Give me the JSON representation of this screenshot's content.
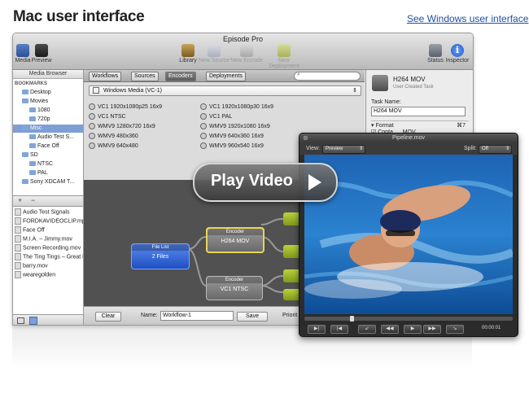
{
  "page": {
    "title": "Mac user interface",
    "windows_link": "See Windows user interface"
  },
  "window": {
    "title": "Episode Pro",
    "toolbar": {
      "media": "Media",
      "preview": "Preview",
      "library": "Library",
      "new_source": "New Source",
      "new_encode": "New Encode",
      "new_deployment": "New Deployment",
      "status": "Status",
      "inspector": "Inspector"
    }
  },
  "sidebar": {
    "header": "Media Browser",
    "tree": [
      {
        "label": "BOOKMARKS",
        "indent": 0
      },
      {
        "label": "Desktop",
        "indent": 1
      },
      {
        "label": "Movies",
        "indent": 1
      },
      {
        "label": "1080",
        "indent": 2
      },
      {
        "label": "720p",
        "indent": 2
      },
      {
        "label": "Misc",
        "indent": 1,
        "selected": true
      },
      {
        "label": "Audio Test S...",
        "indent": 2
      },
      {
        "label": "Face Off",
        "indent": 2
      },
      {
        "label": "SD",
        "indent": 1
      },
      {
        "label": "NTSC",
        "indent": 2
      },
      {
        "label": "PAL",
        "indent": 2
      },
      {
        "label": "Sony XDCAM T...",
        "indent": 1
      }
    ],
    "files": [
      "Audio Test Signals",
      "FORDKAVIDEOCLIP.mpg",
      "Face Off",
      "M.I.A. – Jimmy.mov",
      "Screen Recording.mov",
      "The Ting Tings – Great DJ...",
      "barry.mov",
      "wearegolden"
    ],
    "add_symbol": "+",
    "remove_symbol": "−"
  },
  "tabs": [
    "Workflows",
    "Sources",
    "Encoders",
    "Deployments"
  ],
  "format_dropdown": "Windows Media (VC-1)",
  "encoders_left": [
    "VC1 1920x1080p25 16x9",
    "VC1 NTSC",
    "WMV9 1280x720 16x9",
    "WMV9 480x360",
    "WMV9 640x480"
  ],
  "encoders_right": [
    "VC1 1920x1080p30 16x9",
    "VC1 PAL",
    "WMV9 1920x1080 16x9",
    "WMV9 640x360 16x9",
    "WMV9 960x540 16x9"
  ],
  "workflow": {
    "file_list_title": "File List",
    "file_list_body": "2 Files",
    "encoder1_title": "Encoder",
    "encoder1_body": "H264 MOV",
    "encoder2_title": "Encoder",
    "encoder2_body": "VC1 NTSC"
  },
  "bottom": {
    "clear": "Clear",
    "name_label": "Name:",
    "name_value": "Workflow-1",
    "save": "Save",
    "priority": "Priorit"
  },
  "inspector": {
    "title": "H264 MOV",
    "subtitle": "User Created Task",
    "task_name_label": "Task Name:",
    "task_name_value": "H264 MOV",
    "format_section": "Format",
    "container_label": "Conta...",
    "container_value": "MOV",
    "shortcut": "⌘7"
  },
  "video_window": {
    "title": "Pipeline.mov",
    "view_label": "View:",
    "view_value": "Preview",
    "split_label": "Split:",
    "split_value": "Off",
    "timecode": "00:00:01",
    "controls": [
      "▶|",
      "|◀",
      "↙",
      "◀◀",
      "▶",
      "▶▶",
      "↘"
    ]
  },
  "play_overlay": {
    "label": "Play Video"
  },
  "colors": {
    "link": "#1f4fa3",
    "selection": "#7d9fd6",
    "file_list_node": "#2a5fd0",
    "encoder_node": "#8a8a8a",
    "deploy_node": "#9bb52a"
  }
}
